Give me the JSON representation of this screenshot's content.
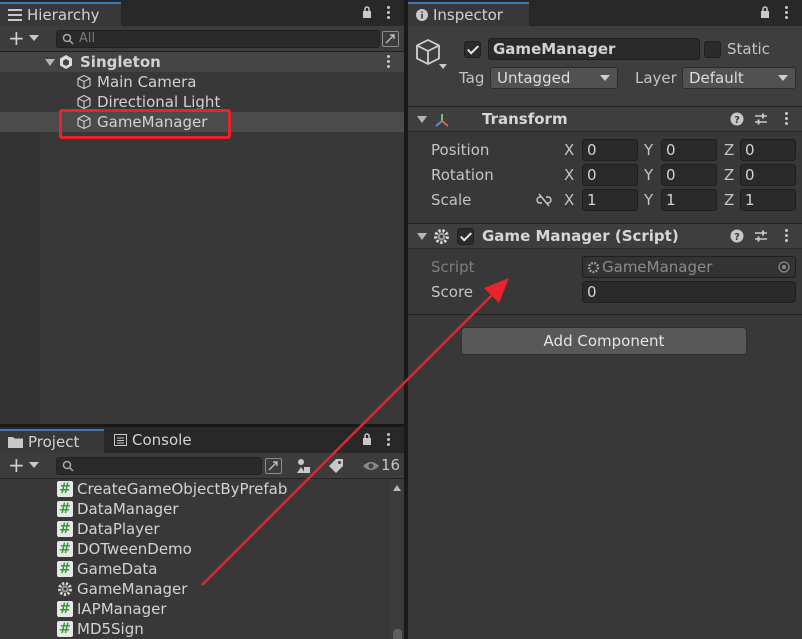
{
  "hierarchy": {
    "tab_label": "Hierarchy",
    "search_placeholder": "All",
    "scene_name": "Singleton",
    "items": [
      {
        "label": "Main Camera"
      },
      {
        "label": "Directional Light"
      },
      {
        "label": "GameManager"
      }
    ]
  },
  "inspector": {
    "tab_label": "Inspector",
    "object_name": "GameManager",
    "static_label": "Static",
    "tag_label": "Tag",
    "tag_value": "Untagged",
    "layer_label": "Layer",
    "layer_value": "Default",
    "transform": {
      "title": "Transform",
      "rows": [
        {
          "label": "Position",
          "x": "0",
          "y": "0",
          "z": "0"
        },
        {
          "label": "Rotation",
          "x": "0",
          "y": "0",
          "z": "0"
        },
        {
          "label": "Scale",
          "x": "1",
          "y": "1",
          "z": "1"
        }
      ],
      "axis_x": "X",
      "axis_y": "Y",
      "axis_z": "Z"
    },
    "script_component": {
      "title": "Game Manager (Script)",
      "script_label": "Script",
      "script_value": "GameManager",
      "score_label": "Score",
      "score_value": "0"
    },
    "add_component_label": "Add Component"
  },
  "project": {
    "tab_label": "Project",
    "console_tab_label": "Console",
    "hidden_count": "16",
    "files": [
      {
        "label": "CreateGameObjectByPrefab",
        "icon": "script-icon"
      },
      {
        "label": "DataManager",
        "icon": "script-icon"
      },
      {
        "label": "DataPlayer",
        "icon": "script-icon"
      },
      {
        "label": "DOTweenDemo",
        "icon": "script-icon"
      },
      {
        "label": "GameData",
        "icon": "script-icon"
      },
      {
        "label": "GameManager",
        "icon": "gear-icon"
      },
      {
        "label": "IAPManager",
        "icon": "script-icon"
      },
      {
        "label": "MD5Sign",
        "icon": "script-icon"
      }
    ]
  },
  "colors": {
    "highlight": "#e8232b",
    "tab_accent": "#3a79bb"
  }
}
